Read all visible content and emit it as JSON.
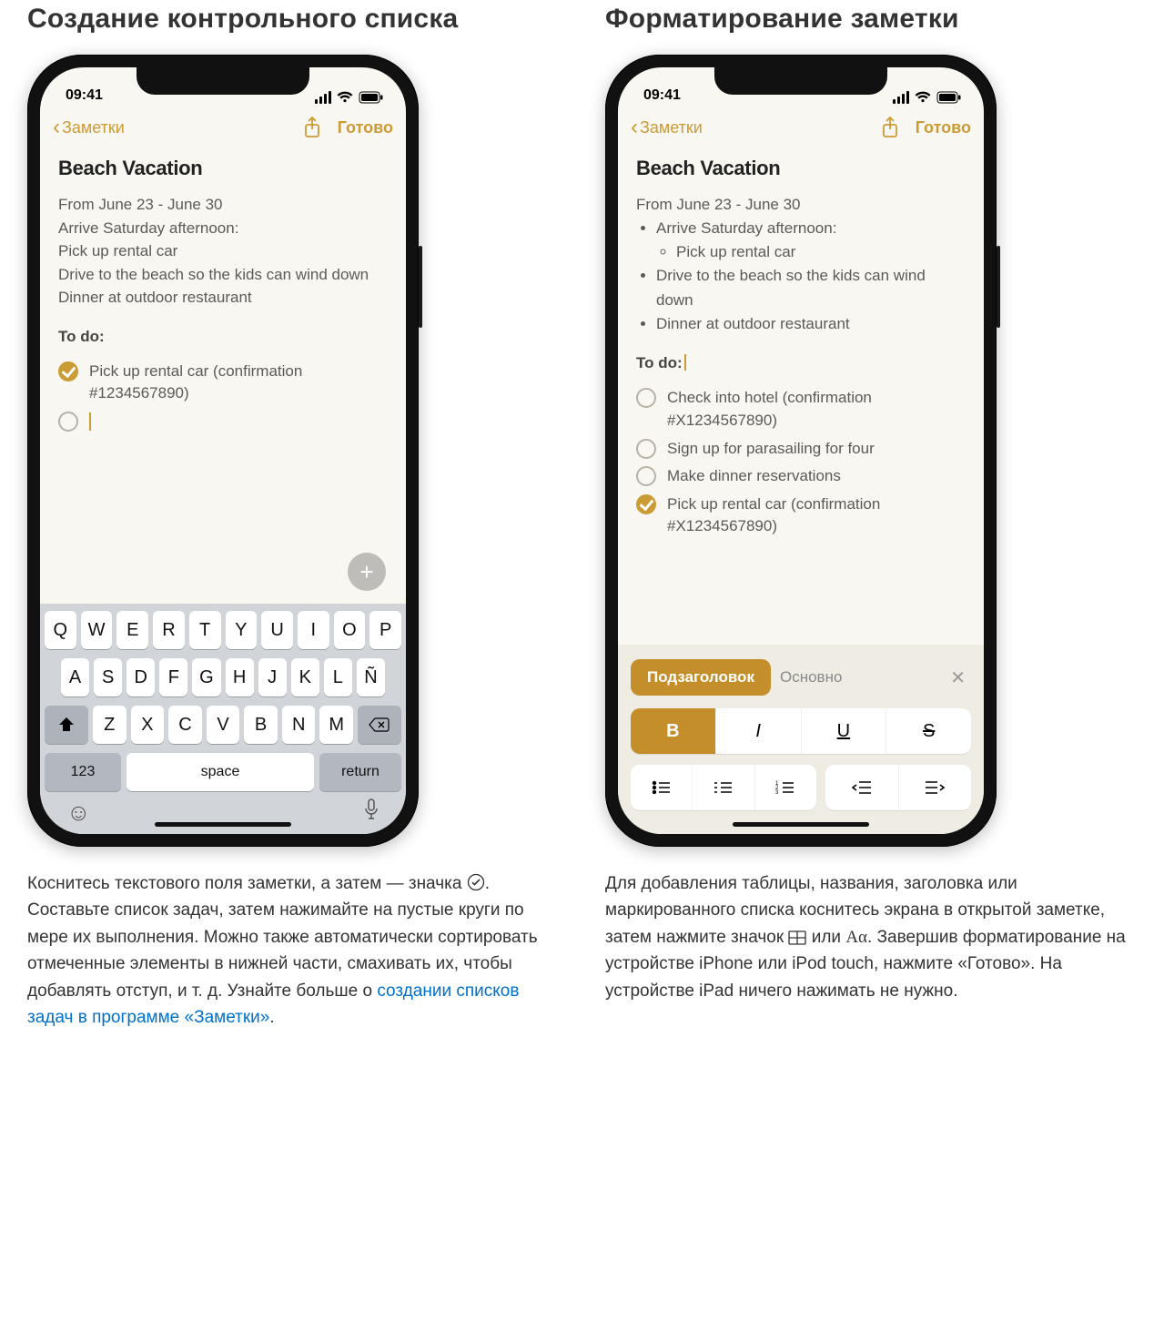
{
  "left": {
    "heading": "Создание контрольного списка",
    "status_time": "09:41",
    "nav_back": "Заметки",
    "nav_done": "Готово",
    "note_title": "Beach Vacation",
    "body_lines": [
      "From June 23 - June 30",
      "Arrive Saturday afternoon:",
      "Pick up rental car",
      "Drive to the beach so the kids can wind down",
      "Dinner at outdoor restaurant"
    ],
    "todo_label": "To do:",
    "todos": [
      {
        "done": true,
        "text": "Pick up rental car (confirmation #1234567890)"
      }
    ],
    "keyboard": {
      "row1": [
        "Q",
        "W",
        "E",
        "R",
        "T",
        "Y",
        "U",
        "I",
        "O",
        "P"
      ],
      "row2": [
        "A",
        "S",
        "D",
        "F",
        "G",
        "H",
        "J",
        "K",
        "L",
        "Ñ"
      ],
      "row3": [
        "Z",
        "X",
        "C",
        "V",
        "B",
        "N",
        "M"
      ],
      "k123": "123",
      "space": "space",
      "ret": "return"
    },
    "caption_pre": "Коснитесь текстового поля заметки, а затем — значка ",
    "caption_post": ". Составьте список задач, затем нажимайте на пустые круги по мере их выполнения. Можно также автоматически сортировать отмеченные элементы в нижней части, смахивать их, чтобы добавлять отступ, и т. д. Узнайте больше о ",
    "caption_link": "создании списков задач в программе «Заметки»",
    "caption_end": "."
  },
  "right": {
    "heading": "Форматирование заметки",
    "status_time": "09:41",
    "nav_back": "Заметки",
    "nav_done": "Готово",
    "note_title": "Beach Vacation",
    "lead_line": "From June 23 - June 30",
    "bullets": [
      "Arrive Saturday afternoon:",
      "Drive to the beach so the kids can wind down",
      "Dinner at outdoor restaurant"
    ],
    "sub_bullet": "Pick up rental car",
    "todo_label": "To do:",
    "todos": [
      {
        "done": false,
        "text": "Check into hotel (confirmation #X1234567890)"
      },
      {
        "done": false,
        "text": "Sign up for parasailing for four"
      },
      {
        "done": false,
        "text": "Make dinner reservations"
      },
      {
        "done": true,
        "text": "Pick up rental car (confirmation #X1234567890)"
      }
    ],
    "format": {
      "style_primary": "Подзаголовок",
      "style_secondary": "Основно",
      "bold": "B",
      "italic": "I",
      "underline": "U",
      "strike": "S"
    },
    "caption_pre": "Для добавления таблицы, названия, заголовка или маркированного списка коснитесь экрана в открытой заметке, затем нажмите значок ",
    "caption_mid": " или ",
    "caption_aa": "Aα",
    "caption_post": ". Завершив форматирование на устройстве iPhone или iPod touch, нажмите «Готово». На устройстве iPad ничего нажимать не нужно."
  }
}
